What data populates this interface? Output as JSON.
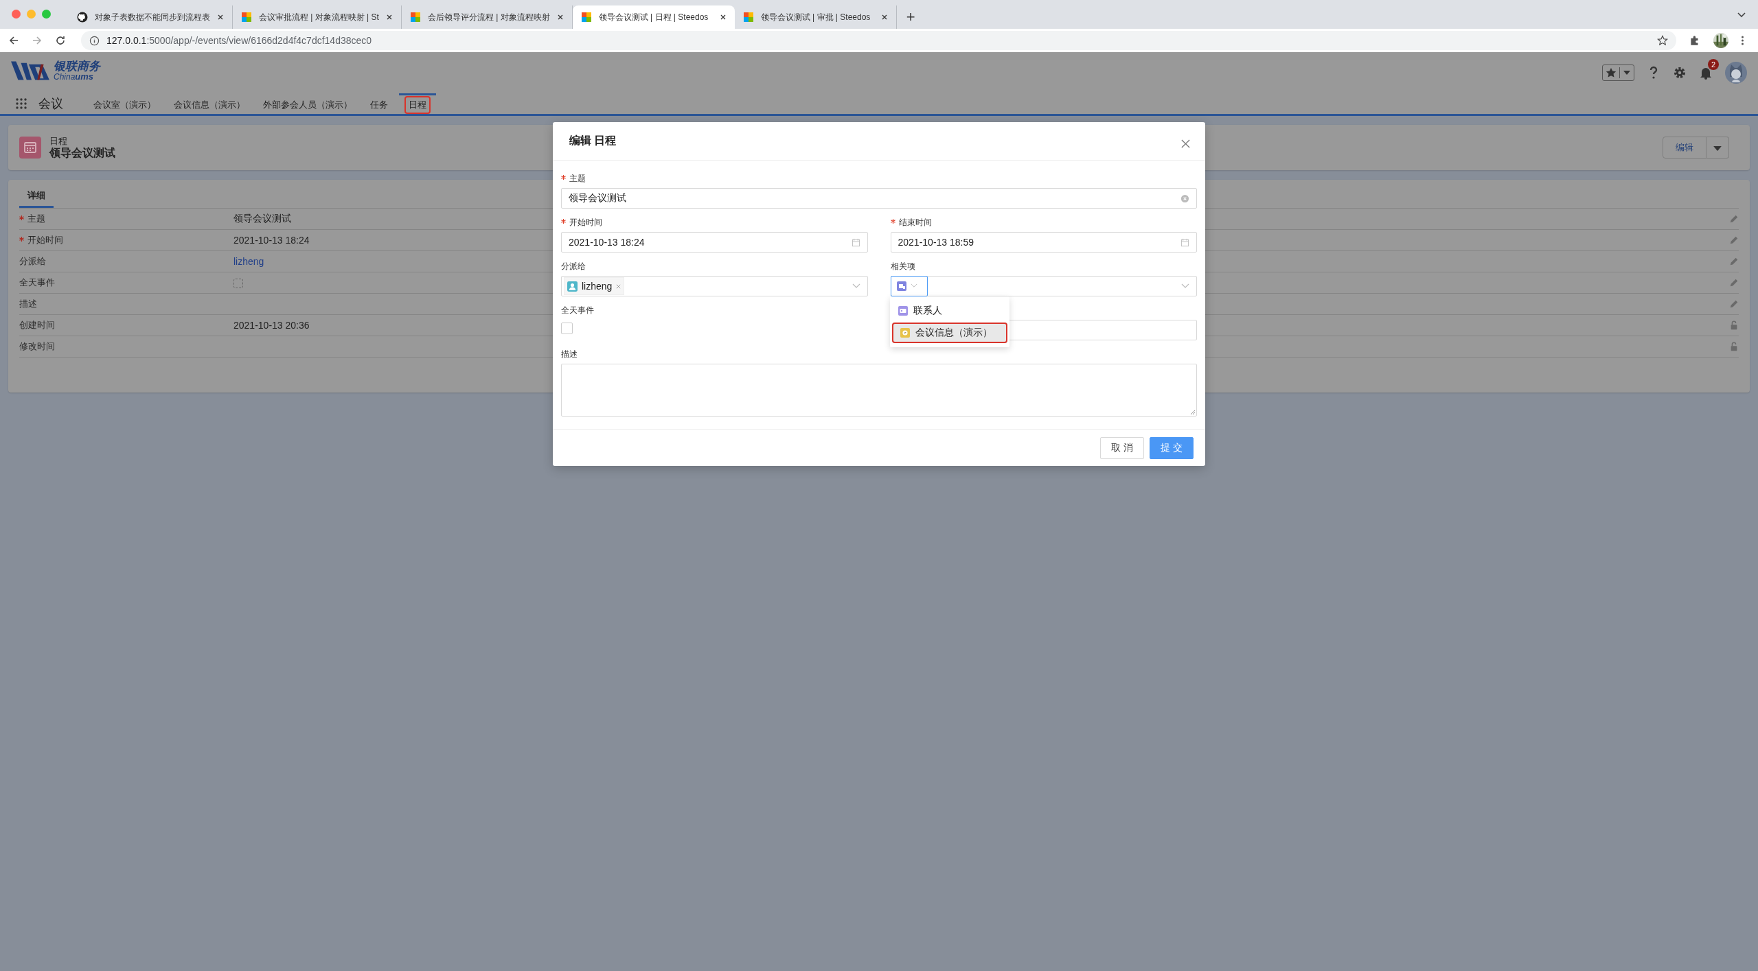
{
  "browser": {
    "tabs": [
      {
        "title": "对象子表数据不能同步到流程表",
        "kind": "github",
        "selected": false
      },
      {
        "title": "会议审批流程 | 对象流程映射 | St",
        "kind": "steedos",
        "selected": false
      },
      {
        "title": "会后领导评分流程 | 对象流程映射",
        "kind": "steedos",
        "selected": false
      },
      {
        "title": "领导会议测试 | 日程 | Steedos",
        "kind": "steedos",
        "selected": true
      },
      {
        "title": "领导会议测试 | 审批 | Steedos",
        "kind": "steedos",
        "selected": false
      }
    ],
    "new_tab": "+",
    "url": {
      "host": "127.0.0.1",
      "path": ":5000/app/-/events/view/6166d2d4f4c7dcf14d38cec0"
    }
  },
  "app": {
    "logo": {
      "name": "银联商务",
      "latin": "China",
      "latin_bold": "ums"
    },
    "name": "会议",
    "nav": [
      {
        "label": "会议室（演示）",
        "selected": false,
        "annotated": false
      },
      {
        "label": "会议信息（演示）",
        "selected": false,
        "annotated": false
      },
      {
        "label": "外部参会人员（演示）",
        "selected": false,
        "annotated": false
      },
      {
        "label": "任务",
        "selected": false,
        "annotated": false
      },
      {
        "label": "日程",
        "selected": true,
        "annotated": true
      }
    ],
    "notification_count": "2"
  },
  "record": {
    "object_label": "日程",
    "title": "领导会议测试",
    "edit_button": "编辑",
    "tabs": [
      {
        "label": "详细",
        "selected": true
      }
    ],
    "fields": [
      {
        "label": "主题",
        "required": true,
        "kind": "text",
        "value": "领导会议测试",
        "editable": true
      },
      {
        "label": "开始时间",
        "required": true,
        "kind": "text",
        "value": "2021-10-13 18:24",
        "editable": true
      },
      {
        "label": "分派给",
        "required": false,
        "kind": "link",
        "value": "lizheng",
        "editable": true
      },
      {
        "label": "全天事件",
        "required": false,
        "kind": "checkbox",
        "checked": false,
        "editable": true
      },
      {
        "label": "描述",
        "required": false,
        "kind": "text",
        "editable": true
      },
      {
        "label": "创建时间",
        "required": false,
        "kind": "text",
        "value": "2021-10-13 20:36",
        "editable": false
      },
      {
        "label": "修改时间",
        "required": false,
        "kind": "text",
        "editable": false
      }
    ]
  },
  "modal": {
    "title": "编辑 日程",
    "subject": {
      "label": "主题",
      "required": true,
      "value": "领导会议测试"
    },
    "start": {
      "label": "开始时间",
      "required": true,
      "value": "2021-10-13 18:24"
    },
    "end": {
      "label": "结束时间",
      "required": true,
      "value": "2021-10-13 18:59"
    },
    "assignee": {
      "label": "分派给",
      "value": "lizheng"
    },
    "related": {
      "label": "相关项"
    },
    "all_day": {
      "label": "全天事件",
      "checked": false
    },
    "description": {
      "label": "描述"
    },
    "dropdown": [
      {
        "label": "联系人",
        "kind": "contact",
        "selected": false,
        "annotated": false
      },
      {
        "label": "会议信息（演示）",
        "kind": "meeting",
        "selected": true,
        "annotated": true
      }
    ],
    "buttons": [
      {
        "label": "取 消",
        "kind": "default"
      },
      {
        "label": "提 交",
        "kind": "primary"
      }
    ]
  }
}
